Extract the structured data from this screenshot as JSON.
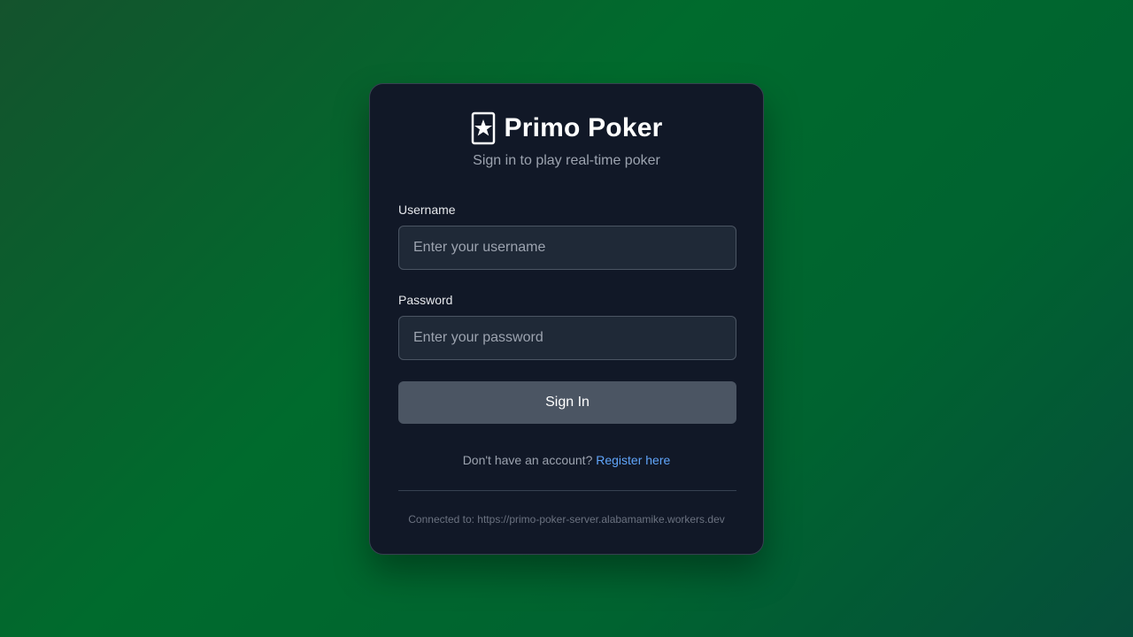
{
  "app": {
    "title": "Primo Poker",
    "subtitle": "Sign in to play real-time poker",
    "logo_icon": "card-star-icon"
  },
  "form": {
    "username_label": "Username",
    "username_placeholder": "Enter your username",
    "username_value": "",
    "password_label": "Password",
    "password_placeholder": "Enter your password",
    "password_value": "",
    "submit_label": "Sign In"
  },
  "register": {
    "prompt": "Don't have an account?",
    "link_label": "Register here"
  },
  "footer": {
    "connection_text": "Connected to: https://primo-poker-server.alabamamike.workers.dev"
  },
  "colors": {
    "card_bg": "#111827",
    "input_bg": "#1f2937",
    "button_bg": "#4b5563",
    "link": "#60a5fa"
  }
}
